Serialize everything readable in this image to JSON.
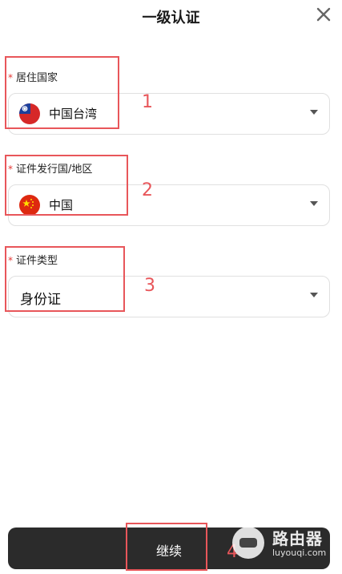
{
  "header": {
    "title": "一级认证"
  },
  "form": {
    "required_mark": "*",
    "residence": {
      "label": "居住国家",
      "value": "中国台湾",
      "flag_icon": "taiwan-flag-icon"
    },
    "issuing": {
      "label": "证件发行国/地区",
      "value": "中国",
      "flag_icon": "china-flag-icon"
    },
    "doc_type": {
      "label": "证件类型",
      "value": "身份证"
    }
  },
  "annotations": [
    "1",
    "2",
    "3",
    "4"
  ],
  "footer": {
    "continue_label": "继续"
  },
  "watermark": {
    "title": "路由器",
    "subtitle": "luyouqi.com"
  },
  "colors": {
    "accent": "#e8565a",
    "button": "#2b2b2b",
    "required": "#e53935"
  }
}
